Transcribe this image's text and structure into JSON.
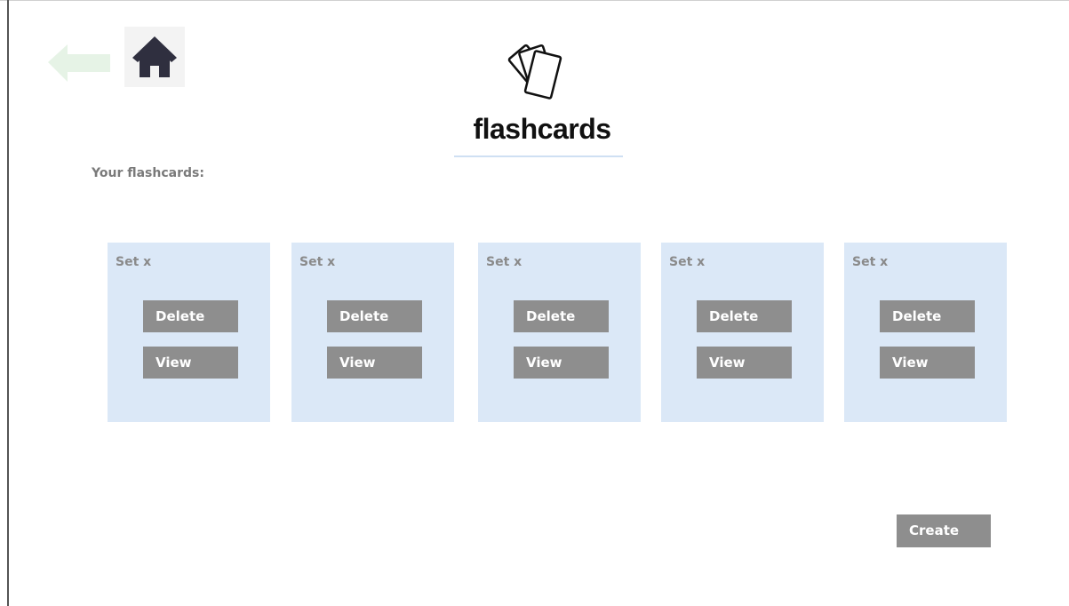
{
  "header": {
    "back_icon": "arrow-left-icon",
    "home_icon": "home-icon",
    "logo_icon": "cards-icon",
    "logo_text": "flashcards"
  },
  "main": {
    "section_label": "Your flashcards:",
    "sets": [
      {
        "title": "Set x",
        "delete_label": "Delete",
        "view_label": "View"
      },
      {
        "title": "Set x",
        "delete_label": "Delete",
        "view_label": "View"
      },
      {
        "title": "Set x",
        "delete_label": "Delete",
        "view_label": "View"
      },
      {
        "title": "Set x",
        "delete_label": "Delete",
        "view_label": "View"
      },
      {
        "title": "Set x",
        "delete_label": "Delete",
        "view_label": "View"
      }
    ],
    "create_label": "Create"
  },
  "colors": {
    "card_background": "#dbe8f7",
    "button_background": "#8e8e8e",
    "back_arrow": "#e6f3e6",
    "home_icon": "#2f2f3f"
  }
}
